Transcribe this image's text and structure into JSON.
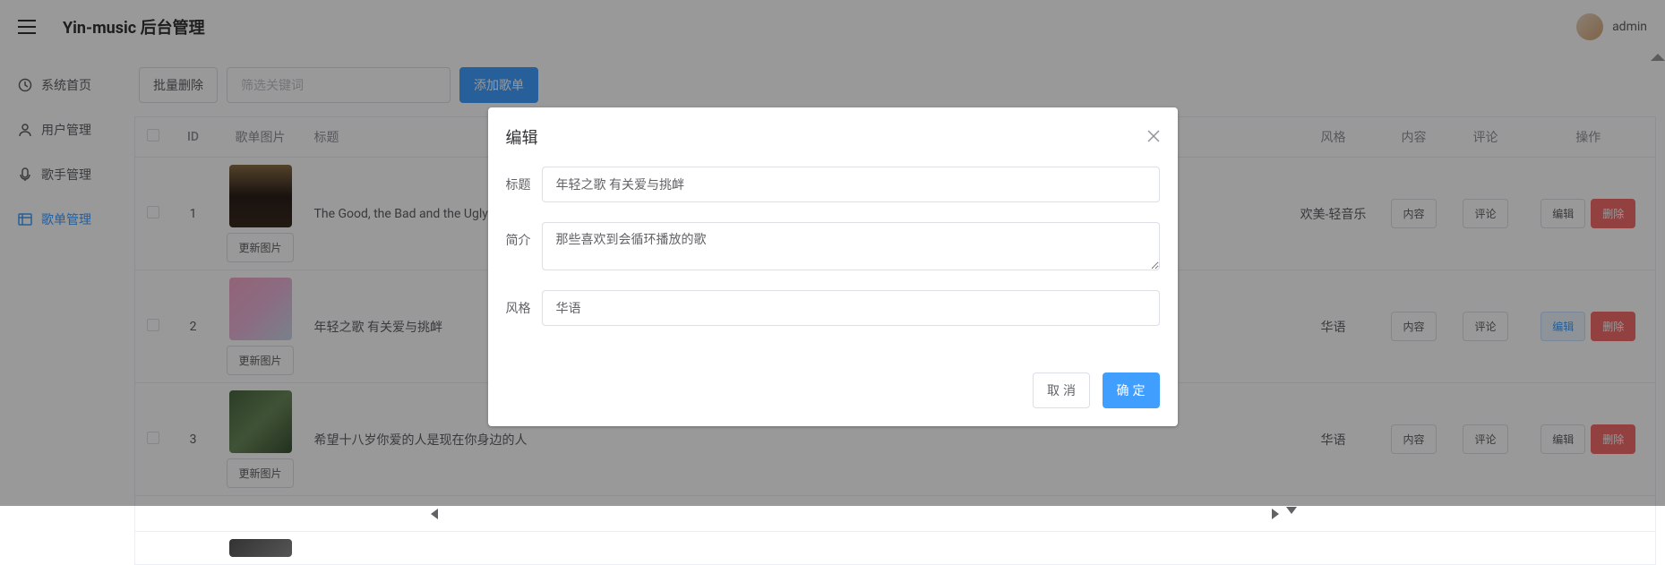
{
  "header": {
    "title": "Yin-music 后台管理",
    "username": "admin"
  },
  "sidebar": {
    "items": [
      {
        "label": "系统首页",
        "icon": "clock"
      },
      {
        "label": "用户管理",
        "icon": "user"
      },
      {
        "label": "歌手管理",
        "icon": "mic"
      },
      {
        "label": "歌单管理",
        "icon": "list"
      }
    ]
  },
  "toolbar": {
    "batch_delete": "批量删除",
    "search_placeholder": "筛选关键词",
    "add_playlist": "添加歌单"
  },
  "table": {
    "columns": {
      "id": "ID",
      "cover": "歌单图片",
      "title": "标题",
      "style": "风格",
      "content": "内容",
      "comment": "评论",
      "action": "操作"
    },
    "update_image": "更新图片",
    "content_btn": "内容",
    "comment_btn": "评论",
    "edit_btn": "编辑",
    "delete_btn": "删除",
    "rows": [
      {
        "id": "1",
        "title": "The Good, the Bad and the Ugly",
        "style": "欢美-轻音乐"
      },
      {
        "id": "2",
        "title": "年轻之歌 有关爱与挑衅",
        "style": "华语"
      },
      {
        "id": "3",
        "title": "希望十八岁你爱的人是现在你身边的人",
        "style": "华语"
      }
    ]
  },
  "modal": {
    "title": "编辑",
    "labels": {
      "title": "标题",
      "intro": "简介",
      "style": "风格"
    },
    "values": {
      "title": "年轻之歌 有关爱与挑衅",
      "intro": "那些喜欢到会循环播放的歌",
      "style": "华语"
    },
    "cancel": "取消",
    "confirm": "确定"
  }
}
